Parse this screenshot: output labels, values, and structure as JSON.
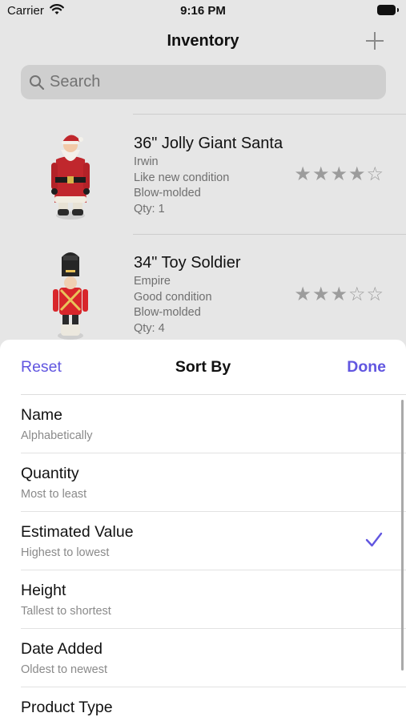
{
  "status_bar": {
    "carrier": "Carrier",
    "time": "9:16 PM"
  },
  "nav": {
    "title": "Inventory",
    "add_icon": "plus-icon"
  },
  "search": {
    "placeholder": "Search"
  },
  "items": [
    {
      "name": "36\" Jolly Giant Santa",
      "brand": "Irwin",
      "condition": "Like new condition",
      "material": "Blow-molded",
      "qty": "Qty: 1",
      "rating": 4,
      "rating_max": 5,
      "stars": "★★★★☆"
    },
    {
      "name": "34\" Toy Soldier",
      "brand": "Empire",
      "condition": "Good condition",
      "material": "Blow-molded",
      "qty": "Qty: 4",
      "rating": 3,
      "rating_max": 5,
      "stars": "★★★☆☆"
    }
  ],
  "sheet": {
    "reset_label": "Reset",
    "title": "Sort By",
    "done_label": "Done",
    "selected": "Estimated Value",
    "options": [
      {
        "label": "Name",
        "sub": "Alphabetically"
      },
      {
        "label": "Quantity",
        "sub": "Most to least"
      },
      {
        "label": "Estimated Value",
        "sub": "Highest to lowest"
      },
      {
        "label": "Height",
        "sub": "Tallest to shortest"
      },
      {
        "label": "Date Added",
        "sub": "Oldest to newest"
      },
      {
        "label": "Product Type",
        "sub": ""
      }
    ]
  },
  "colors": {
    "accent": "#6156e0",
    "dim_background": "#e6e6e6"
  }
}
